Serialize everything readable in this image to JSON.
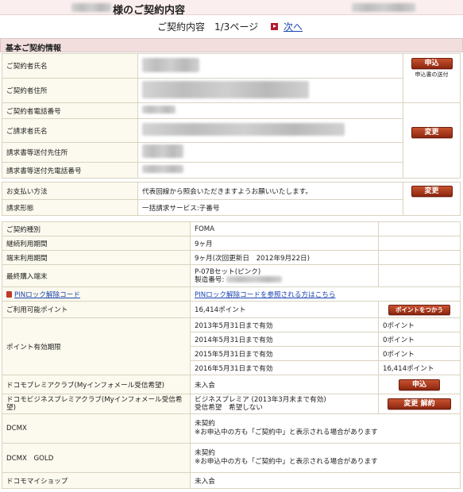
{
  "header": {
    "title": "様のご契約内容"
  },
  "nav": {
    "page_label": "ご契約内容　1/3ページ",
    "next_label": "次へ"
  },
  "section_basic": {
    "title": "基本ご契約情報"
  },
  "basic_info": {
    "rows": [
      {
        "label": "ご契約者氏名"
      },
      {
        "label": "ご契約者住所"
      },
      {
        "label": "ご契約者電話番号"
      },
      {
        "label": "ご請求者氏名"
      },
      {
        "label": "請求書等送付先住所"
      },
      {
        "label": "請求書等送付先電話番号"
      }
    ],
    "apply_button": "申込",
    "apply_caption": "申込書の送付",
    "change_button": "変更"
  },
  "payment": {
    "method_label": "お支払い方法",
    "method_value": "代表回線から照会いただきますようお願いいたします。",
    "form_label": "請求形態",
    "form_value": "一括請求サービス:子番号",
    "change_button": "変更"
  },
  "contract": {
    "type_label": "ご契約種別",
    "type_value": "FOMA",
    "period_label": "継続利用期間",
    "period_value": "9ヶ月",
    "device_period_label": "端末利用期間",
    "device_period_value": "9ヶ月(次回更新日　2012年9月22日)",
    "last_device_label": "最終購入端末",
    "last_device_value": "P-07Bセット(ピンク)",
    "serial_label": "製造番号:",
    "pin_link": "PINロック解除コード",
    "pin_help_link": "PINロック解除コードを参照される方はこちら",
    "points_label": "ご利用可能ポイント",
    "points_value": "16,414ポイント",
    "points_button": "ポイントをつかう",
    "expiry_label": "ポイント有効期限",
    "expiry": [
      {
        "date": "2013年5月31日まで有効",
        "points": "0ポイント"
      },
      {
        "date": "2014年5月31日まで有効",
        "points": "0ポイント"
      },
      {
        "date": "2015年5月31日まで有効",
        "points": "0ポイント"
      },
      {
        "date": "2016年5月31日まで有効",
        "points": "16,414ポイント"
      }
    ],
    "premier_label": "ドコモプレミアクラブ(Myインフォメール受信希望)",
    "premier_value": "未入会",
    "premier_button": "申込",
    "biz_label": "ドコモビジネスプレミアクラブ(Myインフォメール受信希望)",
    "biz_value1": "ビジネスプレミア (2013年3月末まで有効)",
    "biz_value2": "受信希望　希望しない",
    "biz_change": "変更",
    "biz_cancel": "解約",
    "dcmx_label": "DCMX",
    "dcmx_value1": "未契約",
    "dcmx_value2": "※お申込中の方も「ご契約中」と表示される場合があります",
    "dcmx_gold_label": "DCMX　GOLD",
    "dcmx_gold_value1": "未契約",
    "dcmx_gold_value2": "※お申込中の方も「ご契約中」と表示される場合があります",
    "myshop_label": "ドコモマイショップ",
    "myshop_value": "未入会"
  }
}
